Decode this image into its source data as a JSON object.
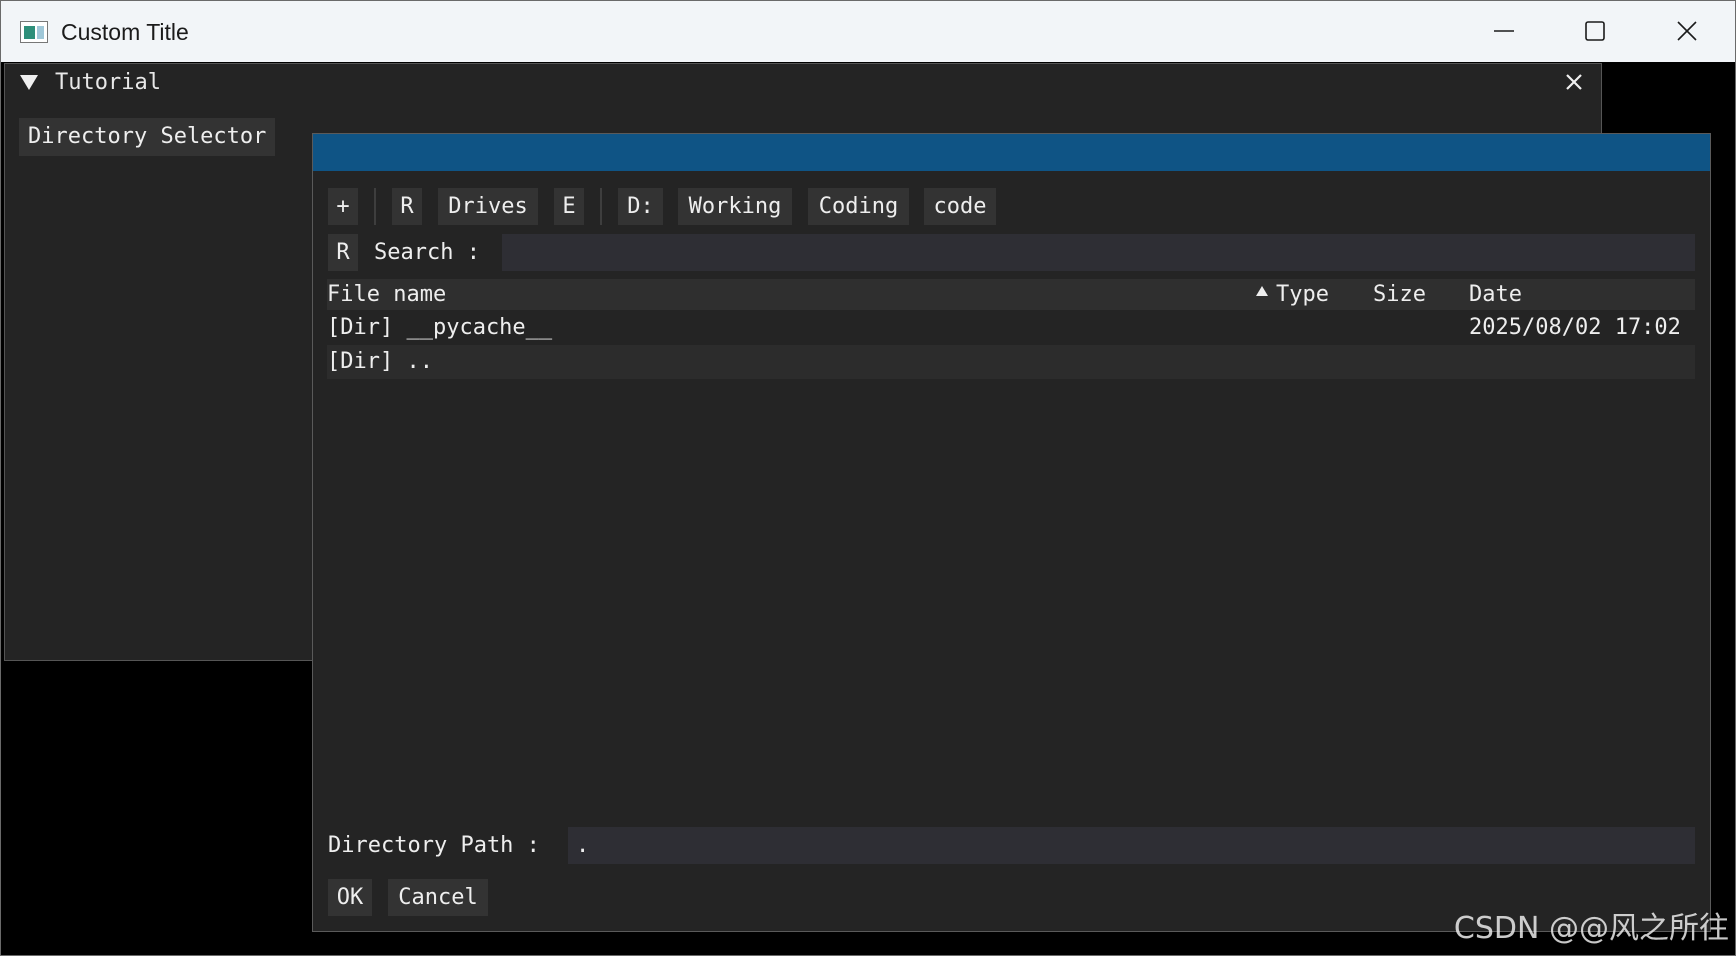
{
  "window": {
    "title": "Custom Title"
  },
  "tutorial": {
    "title": "Tutorial",
    "button_label": "Directory Selector"
  },
  "dialog": {
    "toolbar": {
      "add_label": "+",
      "reset_label": "R",
      "drives_label": "Drives",
      "edit_label": "E",
      "path_buttons": [
        "D:",
        "Working",
        "Coding",
        "code"
      ]
    },
    "search": {
      "reset_label": "R",
      "label": "Search :",
      "value": ""
    },
    "table": {
      "columns": [
        "File name",
        "Type",
        "Size",
        "Date"
      ],
      "rows": [
        {
          "name": "[Dir] __pycache__",
          "type": "",
          "size": "",
          "date": "2025/08/02 17:02"
        },
        {
          "name": "[Dir] ..",
          "type": "",
          "size": "",
          "date": ""
        }
      ]
    },
    "footer": {
      "path_label": "Directory Path :",
      "path_value": ".",
      "ok_label": "OK",
      "cancel_label": "Cancel"
    }
  },
  "watermark": "CSDN @@风之所往"
}
